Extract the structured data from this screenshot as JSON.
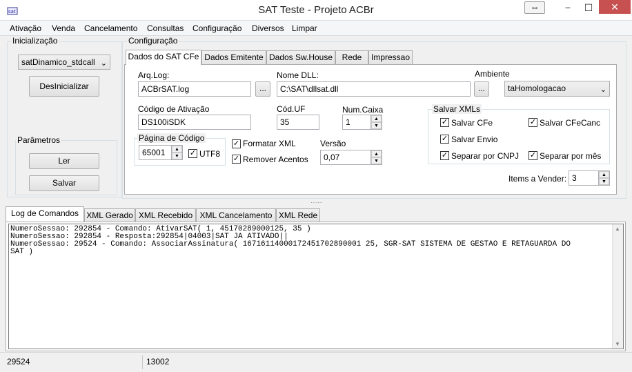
{
  "window": {
    "title": "SAT Teste - Projeto ACBr",
    "restore_glyph": "⇔",
    "min_glyph": "−",
    "max_glyph": "☐",
    "close_glyph": "✕"
  },
  "menu": [
    "Ativação",
    "Venda",
    "Cancelamento",
    "Consultas",
    "Configuração",
    "Diversos",
    "Limpar"
  ],
  "inicializacao": {
    "title": "Inicialização",
    "lib_combo": "satDinamico_stdcall",
    "desinicializar": "DesInicializar",
    "parametros": {
      "title": "Parâmetros",
      "ler": "Ler",
      "salvar": "Salvar"
    }
  },
  "configuracao": {
    "title": "Configuração",
    "tabs": [
      "Dados do SAT CFe",
      "Dados Emitente",
      "Dados Sw.House",
      "Rede",
      "Impressao"
    ],
    "arq_log": {
      "label": "Arq.Log:",
      "value": "ACBrSAT.log",
      "browse": "..."
    },
    "nome_dll": {
      "label": "Nome DLL:",
      "value": "C:\\SAT\\dllsat.dll",
      "browse": "..."
    },
    "ambiente": {
      "label": "Ambiente",
      "value": "taHomologacao"
    },
    "codigo_ativacao": {
      "label": "Código de Ativação",
      "value": "DS100iSDK"
    },
    "cod_uf": {
      "label": "Cód.UF",
      "value": "35"
    },
    "num_caixa": {
      "label": "Num.Caixa",
      "value": "1"
    },
    "pagina_codigo": {
      "title": "Página de Código",
      "value": "65001",
      "utf8": "UTF8",
      "utf8_checked": true
    },
    "formatar_xml": {
      "label": "Formatar XML",
      "checked": true
    },
    "remover_acentos": {
      "label": "Remover Acentos",
      "checked": true
    },
    "versao": {
      "label": "Versão",
      "value": "0,07"
    },
    "salvar_xmls": {
      "title": "Salvar XMLs",
      "salvar_cfe": "Salvar CFe",
      "salvar_cfecanc": "Salvar CFeCanc",
      "salvar_envio": "Salvar Envio",
      "separar_cnpj": "Separar por CNPJ",
      "separar_mes": "Separar por mês"
    },
    "items_vender": {
      "label": "Items a Vender:",
      "value": "3"
    }
  },
  "log_tabs": [
    "Log de Comandos",
    "XML Gerado",
    "XML Recebido",
    "XML Cancelamento",
    "XML Rede"
  ],
  "log_lines": [
    "NumeroSessao: 292854 - Comando: AtivarSAT( 1, 45170289000125, 35 )",
    "NumeroSessao: 292854 - Resposta:292854|04003|SAT JA ATIVADO||",
    "NumeroSessao: 29524 - Comando: AssociarAssinatura( 16716114000172451702890001 25, SGR-SAT SISTEMA DE GESTAO E RETAGUARDA DO",
    "SAT )"
  ],
  "status": {
    "left": "29524",
    "right": "13002"
  },
  "icons": {
    "app": "sat-app-icon",
    "check": "checkmark-icon",
    "up": "spin-up-icon",
    "down": "spin-down-icon",
    "dropdown": "chevron-down-icon"
  },
  "glyphs": {
    "check": "✓",
    "up": "▲",
    "down": "▼",
    "dropdown": "⌄",
    "grip": "......."
  }
}
